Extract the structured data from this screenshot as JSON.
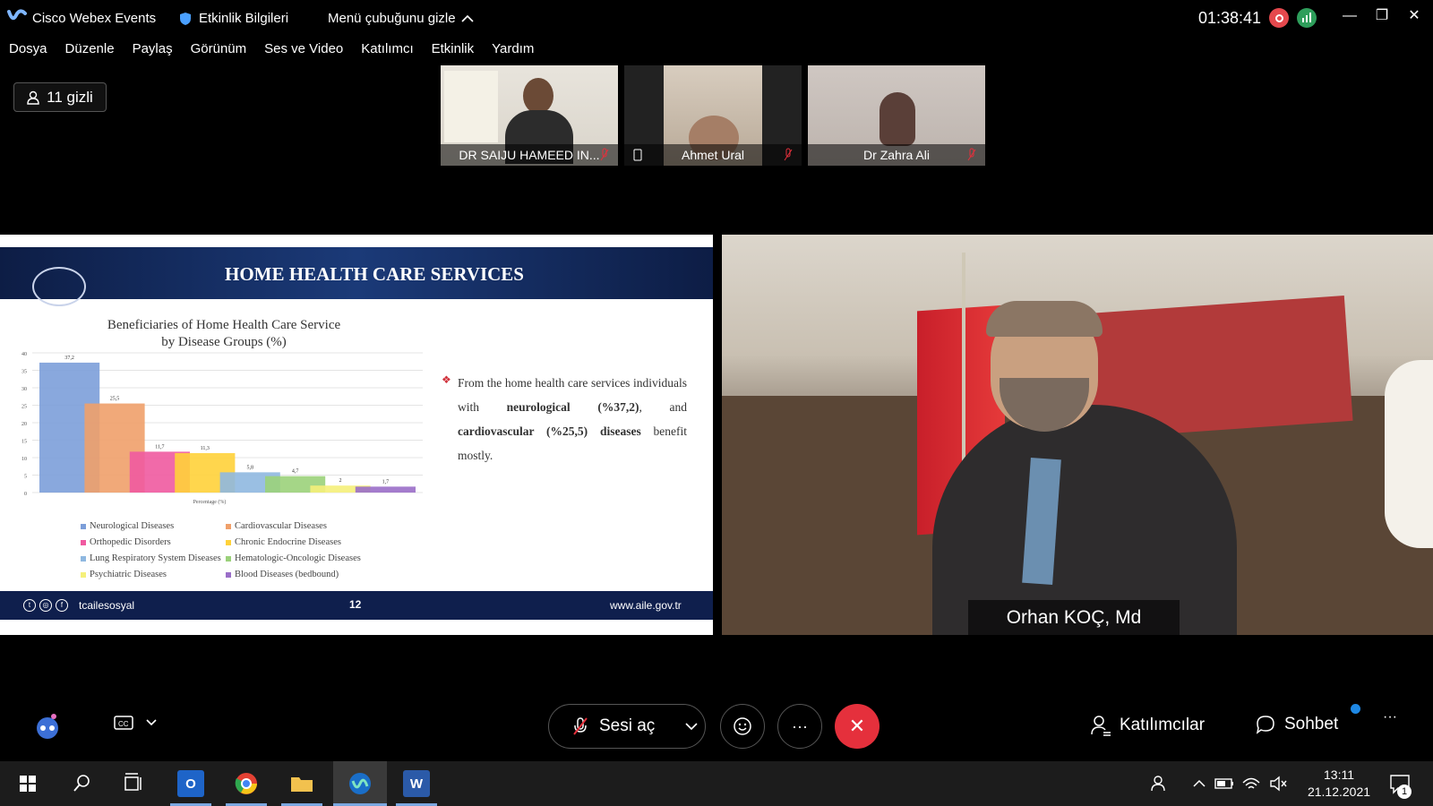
{
  "titlebar": {
    "app_title": "Cisco Webex Events",
    "event_info": "Etkinlik Bilgileri",
    "hide_menu": "Menü çubuğunu gizle",
    "timer": "01:38:41"
  },
  "menubar": [
    "Dosya",
    "Düzenle",
    "Paylaş",
    "Görünüm",
    "Ses ve Video",
    "Katılımcı",
    "Etkinlik",
    "Yardım"
  ],
  "hidden_attendees": "11 gizli",
  "participants": [
    {
      "name": "DR SAIJU HAMEED IN..."
    },
    {
      "name": "Ahmet Ural"
    },
    {
      "name": "Dr Zahra Ali"
    }
  ],
  "slide": {
    "title": "HOME HEALTH CARE SERVICES",
    "chart_title_line1": "Beneficiaries of Home Health Care Service",
    "chart_title_line2": "by Disease Groups (%)",
    "text_part1": "From the home health care services individuals with ",
    "text_bold1": "neurological (%37,2)",
    "text_part2": ", and ",
    "text_bold2": "cardiovascular (%25,5) diseases",
    "text_part3": " benefit mostly.",
    "footer_handle": "tcailesosyal",
    "footer_page": "12",
    "footer_url": "www.aile.gov.tr"
  },
  "chart_data": {
    "type": "bar",
    "title": "Beneficiaries of Home Health Care Service by Disease Groups (%)",
    "xlabel": "Percentage (%)",
    "ylabel": "",
    "ylim": [
      0,
      40
    ],
    "yticks": [
      0,
      5,
      10,
      15,
      20,
      25,
      30,
      35,
      40
    ],
    "categories": [
      "Neurological Diseases",
      "Cardiovascular Diseases",
      "Orthopedic Disorders",
      "Chronic Endocrine Diseases",
      "Lung Respiratory System Diseases",
      "Hematologic-Oncologic Diseases",
      "Psychiatric Diseases",
      "Blood Diseases (bedbound)"
    ],
    "values": [
      37.2,
      25.5,
      11.7,
      11.3,
      5.8,
      4.7,
      2,
      1.7
    ],
    "value_labels": [
      "37,2",
      "25,5",
      "11,7",
      "11,3",
      "5,8",
      "4,7",
      "2",
      "1,7"
    ],
    "colors": [
      "#7c9ed9",
      "#f0a06a",
      "#f05aa0",
      "#ffd23a",
      "#8fb8e0",
      "#9bd17a",
      "#f5f07a",
      "#9a6ec8"
    ],
    "grid": true,
    "legend": "bottom"
  },
  "speaker": {
    "name": "Orhan KOÇ, Md"
  },
  "controls": {
    "unmute": "Sesi aç",
    "participants": "Katılımcılar",
    "chat": "Sohbet"
  },
  "taskbar": {
    "time": "13:11",
    "date": "21.12.2021",
    "notifications": "1"
  },
  "icons": [
    "webex-logo-icon",
    "shield-icon",
    "chevron-up-icon",
    "record-icon",
    "signal-icon",
    "minimize-icon",
    "restore-icon",
    "close-icon",
    "user-icon",
    "mic-muted-icon",
    "cc-icon",
    "reaction-icon",
    "more-icon",
    "end-call-icon",
    "participants-icon",
    "chat-icon",
    "windows-start-icon",
    "search-icon",
    "task-view-icon",
    "outlook-icon",
    "chrome-icon",
    "file-explorer-icon",
    "webex-taskbar-icon",
    "word-icon"
  ]
}
